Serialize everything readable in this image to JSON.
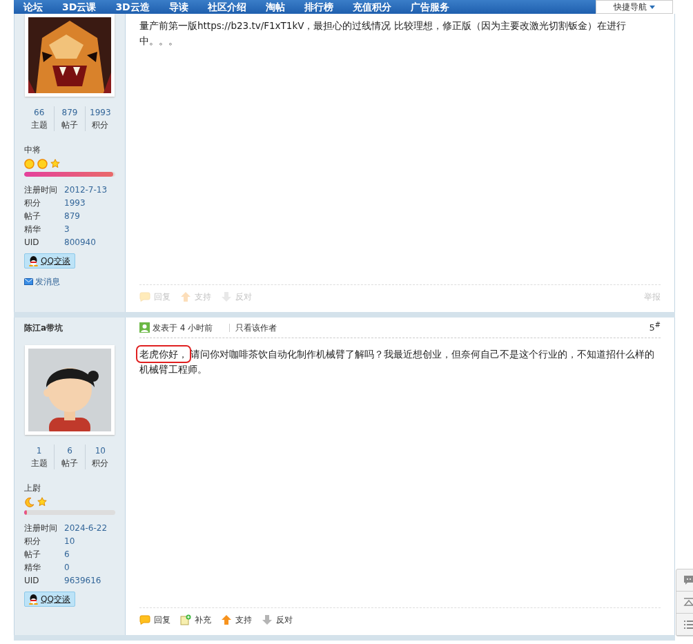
{
  "nav": {
    "items": [
      "论坛",
      "3D云课",
      "3D云造",
      "导读",
      "社区介绍",
      "淘帖",
      "排行榜",
      "充值积分",
      "广告服务"
    ],
    "quick_nav": "快捷导航"
  },
  "posts": [
    {
      "avatar": {
        "kind": "picture"
      },
      "stats": [
        {
          "value": "66",
          "label": "主题"
        },
        {
          "value": "879",
          "label": "帖子"
        },
        {
          "value": "1993",
          "label": "积分"
        }
      ],
      "rank": "中将",
      "rank_icons": [
        {
          "kind": "sun"
        },
        {
          "kind": "sun"
        },
        {
          "kind": "star"
        }
      ],
      "level": 0.98,
      "profile": [
        {
          "label": "注册时间",
          "value": "2012-7-13"
        },
        {
          "label": "积分",
          "value": "1993"
        },
        {
          "label": "帖子",
          "value": "879"
        },
        {
          "label": "精华",
          "value": "3"
        },
        {
          "label": "UID",
          "value": "800940"
        }
      ],
      "qq_button": "QQ交谈",
      "message_link": "发消息",
      "content": [
        {
          "text": "量产前第一版https://b23.tv/F1xT1kV，最担心的过线情况 比较理想，修正版（因为主要改激光切割钣金）在进行中。。。",
          "highlighted": false
        }
      ],
      "actions": [
        {
          "kind": "reply",
          "label": "回复",
          "disabled": true
        },
        {
          "kind": "support",
          "label": "支持",
          "disabled": true
        },
        {
          "kind": "oppose",
          "label": "反对",
          "disabled": true
        }
      ],
      "report": "举报"
    },
    {
      "author": "陈江a带坑",
      "avatar": {
        "kind": "picture"
      },
      "stats": [
        {
          "value": "1",
          "label": "主题"
        },
        {
          "value": "6",
          "label": "帖子"
        },
        {
          "value": "10",
          "label": "积分"
        }
      ],
      "rank": "上尉",
      "rank_icons": [
        {
          "kind": "moon"
        },
        {
          "kind": "star"
        }
      ],
      "level": 0.03,
      "profile": [
        {
          "label": "注册时间",
          "value": "2024-6-22"
        },
        {
          "label": "积分",
          "value": "10"
        },
        {
          "label": "帖子",
          "value": "6"
        },
        {
          "label": "精华",
          "value": "0"
        },
        {
          "label": "UID",
          "value": "9639616"
        }
      ],
      "qq_button": "QQ交谈",
      "meta": "发表于 4 小时前",
      "only_author": "只看该作者",
      "floor": "5$^{#}$",
      "content": [
        {
          "text": "老虎你好，",
          "highlighted": true
        },
        {
          "text": "请问你对咖啡茶饮自动化制作机械臂了解吗？我最近想创业，但奈何自己不是这个行业的，不知道招什么样的机械臂工程师。",
          "highlighted": false
        }
      ],
      "actions": [
        {
          "kind": "reply",
          "label": "回复",
          "disabled": false
        },
        {
          "kind": "supplement",
          "label": "补充",
          "disabled": false
        },
        {
          "kind": "support",
          "label": "支持",
          "disabled": false
        },
        {
          "kind": "oppose",
          "label": "反对",
          "disabled": false
        }
      ]
    }
  ]
}
